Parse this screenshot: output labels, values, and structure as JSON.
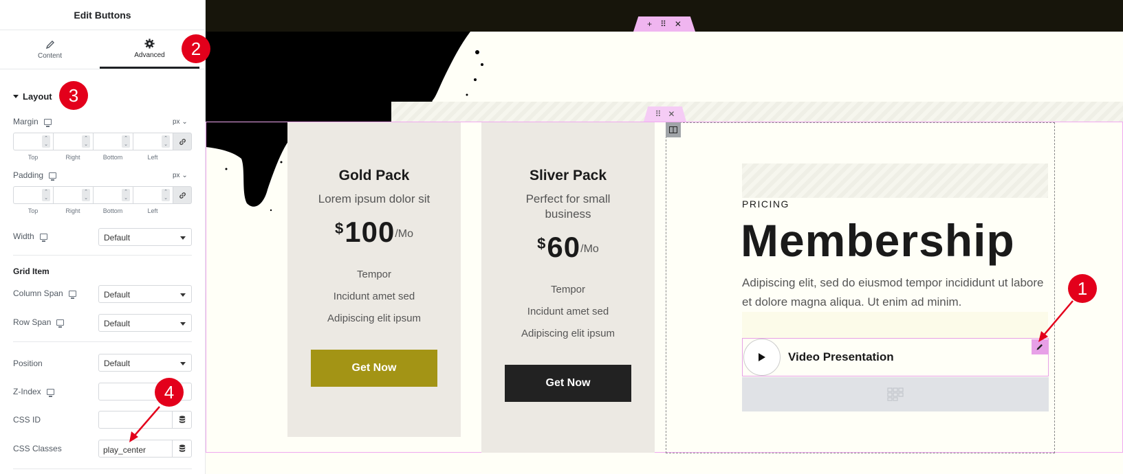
{
  "panel": {
    "title": "Edit Buttons",
    "tabs": [
      {
        "label": "Content",
        "icon": "pencil-icon"
      },
      {
        "label": "Advanced",
        "icon": "gear-icon"
      }
    ],
    "section_title": "Layout",
    "margin": {
      "label": "Margin",
      "unit": "px",
      "fields": [
        "Top",
        "Right",
        "Bottom",
        "Left"
      ]
    },
    "padding": {
      "label": "Padding",
      "unit": "px",
      "fields": [
        "Top",
        "Right",
        "Bottom",
        "Left"
      ]
    },
    "width": {
      "label": "Width",
      "value": "Default"
    },
    "grid_item": {
      "heading": "Grid Item",
      "column_span": {
        "label": "Column Span",
        "value": "Default"
      },
      "row_span": {
        "label": "Row Span",
        "value": "Default"
      }
    },
    "position": {
      "label": "Position",
      "value": "Default"
    },
    "z_index": {
      "label": "Z-Index"
    },
    "css_id": {
      "label": "CSS ID",
      "value": ""
    },
    "css_classes": {
      "label": "CSS Classes",
      "value": "play_center"
    }
  },
  "annotations": [
    "1",
    "2",
    "3",
    "4"
  ],
  "canvas": {
    "cards": [
      {
        "title": "Gold Pack",
        "subtitle": "Lorem ipsum dolor sit",
        "currency": "$",
        "price": "100",
        "period": "/Mo",
        "features": [
          "Tempor",
          "Incidunt amet sed",
          "Adipiscing elit ipsum"
        ],
        "button": "Get Now",
        "button_color": "#a39415"
      },
      {
        "title": "Sliver Pack",
        "subtitle": "Perfect for small business",
        "currency": "$",
        "price": "60",
        "period": "/Mo",
        "features": [
          "Tempor",
          "Incidunt amet sed",
          "Adipiscing elit ipsum"
        ],
        "button": "Get Now",
        "button_color": "#222222"
      }
    ],
    "kicker": "PRICING",
    "heading": "Membership",
    "description": "Adipiscing elit, sed do eiusmod tempor incididunt ut labore et dolore magna aliqua. Ut enim ad minim.",
    "video_button": "Video Presentation"
  },
  "colors": {
    "badge": "#e3001b",
    "selection": "#e7a0e7",
    "top_bar": "#17150b"
  }
}
